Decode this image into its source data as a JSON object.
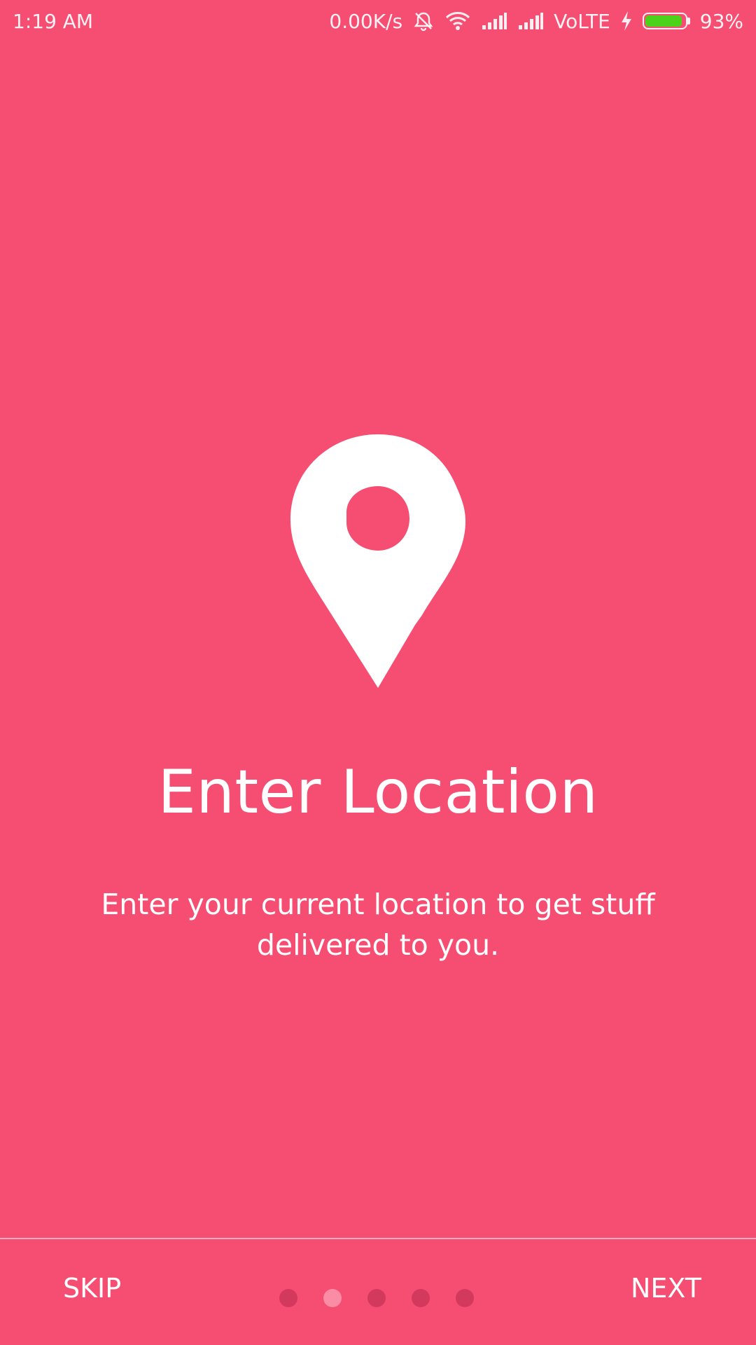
{
  "status_bar": {
    "time": "1:19 AM",
    "network_speed": "0.00K/s",
    "network_type": "VoLTE",
    "battery_percent": "93%",
    "battery_level": 0.93,
    "battery_color": "#4CD219",
    "icons": [
      "alarm-off-icon",
      "wifi-icon",
      "signal-icon",
      "signal-icon",
      "charging-icon",
      "battery-icon"
    ]
  },
  "onboarding": {
    "icon": "location-pin-icon",
    "title": "Enter Location",
    "description": "Enter your current location to get stuff delivered to you."
  },
  "footer": {
    "skip_label": "SKIP",
    "next_label": "NEXT",
    "page_count": 5,
    "active_page": 2
  },
  "colors": {
    "background": "#F64E72",
    "dot_inactive": "#D3395C",
    "dot_active": "#FA8CA6"
  }
}
